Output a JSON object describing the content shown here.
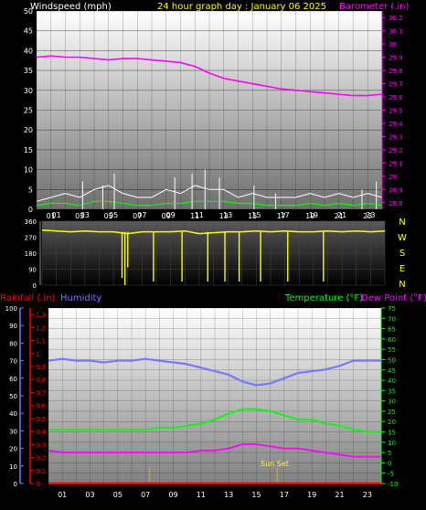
{
  "header": {
    "windspeed_label": "Windspeed (mph)",
    "title": "24 hour graph day : January 06 2025",
    "barometer_label": "Barometer (.in)"
  },
  "legend2": {
    "rainfall_label": "Rainfall (.in)",
    "humidity_label": "Humidity",
    "temperature_label": "Temperature (°F)",
    "dewpoint_label": "Dew Point (°F)"
  },
  "compass_letters": [
    "N",
    "W",
    "S",
    "E",
    "N"
  ],
  "annotation_sunset": "Sun Set",
  "colors": {
    "windspeed": "#ffffff",
    "windgust_avg": "#00ff00",
    "barometer": "#ff00ff",
    "direction": "#ffff00",
    "temperature": "#00ff00",
    "dewpoint": "#ff00ff",
    "humidity": "#7878ff",
    "rainfall": "#ff0000",
    "title": "#ffff00"
  },
  "chart_data": [
    {
      "type": "line",
      "x_ticks": [
        "01",
        "03",
        "05",
        "07",
        "09",
        "11",
        "13",
        "15",
        "17",
        "19",
        "21",
        "23"
      ],
      "y_left_ticks": [
        "0",
        "5",
        "10",
        "15",
        "20",
        "25",
        "30",
        "35",
        "40",
        "45",
        "50"
      ],
      "y_left_range": [
        0,
        50
      ],
      "y_right_ticks": [
        "28.8",
        "28.9",
        "29",
        "29.1",
        "29.2",
        "29.3",
        "29.4",
        "29.5",
        "29.6",
        "29.7",
        "29.8",
        "29.9",
        "30",
        "30.1",
        "30.2"
      ],
      "y_right_range": [
        28.75,
        30.25
      ],
      "series": [
        {
          "name": "Barometer",
          "axis": "right",
          "hours": [
            0,
            1,
            2,
            3,
            4,
            5,
            6,
            7,
            8,
            9,
            10,
            11,
            12,
            13,
            14,
            15,
            16,
            17,
            18,
            19,
            20,
            21,
            22,
            23,
            24
          ],
          "values": [
            29.9,
            29.91,
            29.9,
            29.9,
            29.89,
            29.88,
            29.89,
            29.89,
            29.88,
            29.87,
            29.86,
            29.83,
            29.78,
            29.74,
            29.72,
            29.7,
            29.68,
            29.66,
            29.65,
            29.64,
            29.63,
            29.62,
            29.61,
            29.61,
            29.62
          ]
        },
        {
          "name": "Windspeed",
          "axis": "left",
          "hours": [
            0,
            1,
            2,
            3,
            4,
            5,
            6,
            7,
            8,
            9,
            10,
            11,
            12,
            13,
            14,
            15,
            16,
            17,
            18,
            19,
            20,
            21,
            22,
            23,
            24
          ],
          "values": [
            2,
            3,
            4,
            3,
            5,
            6,
            4,
            3,
            3,
            5,
            4,
            6,
            5,
            5,
            3,
            4,
            3,
            3,
            3,
            4,
            3,
            4,
            3,
            4,
            3
          ],
          "gust_peaks": [
            [
              3.2,
              7
            ],
            [
              4.6,
              6
            ],
            [
              5.4,
              9
            ],
            [
              9.6,
              8
            ],
            [
              10.8,
              9
            ],
            [
              11.7,
              10
            ],
            [
              12.7,
              8
            ],
            [
              15.1,
              6
            ],
            [
              16.6,
              4
            ],
            [
              22.6,
              5
            ],
            [
              23.6,
              7
            ]
          ]
        },
        {
          "name": "Wind average",
          "axis": "left",
          "hours": [
            0,
            1,
            2,
            3,
            4,
            5,
            6,
            7,
            8,
            9,
            10,
            11,
            12,
            13,
            14,
            15,
            16,
            17,
            18,
            19,
            20,
            21,
            22,
            23,
            24
          ],
          "values": [
            1,
            1.5,
            1.5,
            1,
            2,
            2,
            1.5,
            1,
            1,
            1.5,
            1.5,
            2,
            2,
            2,
            1.5,
            1.5,
            1,
            1,
            1,
            1.5,
            1,
            1.5,
            1,
            1.5,
            1
          ]
        }
      ]
    },
    {
      "type": "line",
      "x_ticks": [
        "01",
        "03",
        "05",
        "07",
        "09",
        "11",
        "13",
        "15",
        "17",
        "19",
        "21",
        "23"
      ],
      "y_ticks": [
        "0",
        "90",
        "180",
        "270",
        "360"
      ],
      "y_range": [
        0,
        360
      ],
      "series": [
        {
          "name": "Wind direction",
          "hours": [
            0,
            1,
            2,
            3,
            4,
            5,
            6,
            7,
            8,
            9,
            10,
            11,
            12,
            13,
            14,
            15,
            16,
            17,
            18,
            19,
            20,
            21,
            22,
            23,
            24
          ],
          "values": [
            310,
            305,
            300,
            305,
            300,
            300,
            290,
            300,
            300,
            300,
            305,
            290,
            295,
            300,
            300,
            305,
            300,
            305,
            300,
            300,
            305,
            300,
            305,
            300,
            305
          ],
          "dips": [
            [
              5.6,
              40
            ],
            [
              5.8,
              0
            ],
            [
              6.0,
              100
            ],
            [
              7.8,
              20
            ],
            [
              9.8,
              20
            ],
            [
              11.6,
              20
            ],
            [
              12.8,
              20
            ],
            [
              13.8,
              20
            ],
            [
              15.3,
              20
            ],
            [
              17.2,
              20
            ],
            [
              19.7,
              20
            ]
          ]
        }
      ]
    },
    {
      "type": "line",
      "x_ticks": [
        "01",
        "03",
        "05",
        "07",
        "09",
        "11",
        "13",
        "15",
        "17",
        "19",
        "21",
        "23"
      ],
      "humidity_ticks": [
        "0",
        "10",
        "20",
        "30",
        "40",
        "50",
        "60",
        "70",
        "80",
        "90",
        "100"
      ],
      "humidity_range": [
        0,
        100
      ],
      "rainfall_ticks": [
        "0",
        "0.1",
        "0.2",
        "0.3",
        "0.4",
        "0.5",
        "0.6",
        "0.7",
        "0.8",
        "0.9",
        "1",
        "1.1",
        "1.2",
        "1.3"
      ],
      "rainfall_range": [
        0,
        1.35
      ],
      "temperature_ticks": [
        "-10",
        "-5",
        "0",
        "5",
        "10",
        "15",
        "20",
        "25",
        "30",
        "35",
        "40",
        "45",
        "50",
        "55",
        "60",
        "65",
        "70",
        "75"
      ],
      "temperature_range": [
        -10,
        75
      ],
      "series": [
        {
          "name": "Humidity",
          "axis": "humidity",
          "hours": [
            0,
            1,
            2,
            3,
            4,
            5,
            6,
            7,
            8,
            9,
            10,
            11,
            12,
            13,
            14,
            15,
            16,
            17,
            18,
            19,
            20,
            21,
            22,
            23,
            24
          ],
          "values": [
            70,
            71,
            70,
            70,
            69,
            70,
            70,
            71,
            70,
            69,
            68,
            66,
            64,
            62,
            58,
            56,
            57,
            60,
            63,
            64,
            65,
            67,
            70,
            70,
            70
          ]
        },
        {
          "name": "Temperature",
          "axis": "temperature",
          "hours": [
            0,
            1,
            2,
            3,
            4,
            5,
            6,
            7,
            8,
            9,
            10,
            11,
            12,
            13,
            14,
            15,
            16,
            17,
            18,
            19,
            20,
            21,
            22,
            23,
            24
          ],
          "values": [
            16,
            16,
            16,
            16,
            16,
            16,
            16,
            16,
            17,
            17,
            18,
            19,
            21,
            24,
            26,
            26,
            25,
            23,
            21,
            21,
            19,
            18,
            16,
            15,
            15
          ]
        },
        {
          "name": "Dew Point",
          "axis": "temperature",
          "hours": [
            0,
            1,
            2,
            3,
            4,
            5,
            6,
            7,
            8,
            9,
            10,
            11,
            12,
            13,
            14,
            15,
            16,
            17,
            18,
            19,
            20,
            21,
            22,
            23,
            24
          ],
          "values": [
            6,
            5,
            5,
            5,
            5,
            5,
            5,
            5,
            5,
            5,
            5,
            6,
            6,
            7,
            9,
            9,
            8,
            7,
            7,
            6,
            5,
            4,
            3,
            3,
            3
          ]
        },
        {
          "name": "Rainfall",
          "axis": "rainfall",
          "hours": [
            0,
            24
          ],
          "values": [
            0,
            0
          ]
        }
      ],
      "markers_hours": [
        7.3,
        16.5
      ]
    }
  ]
}
